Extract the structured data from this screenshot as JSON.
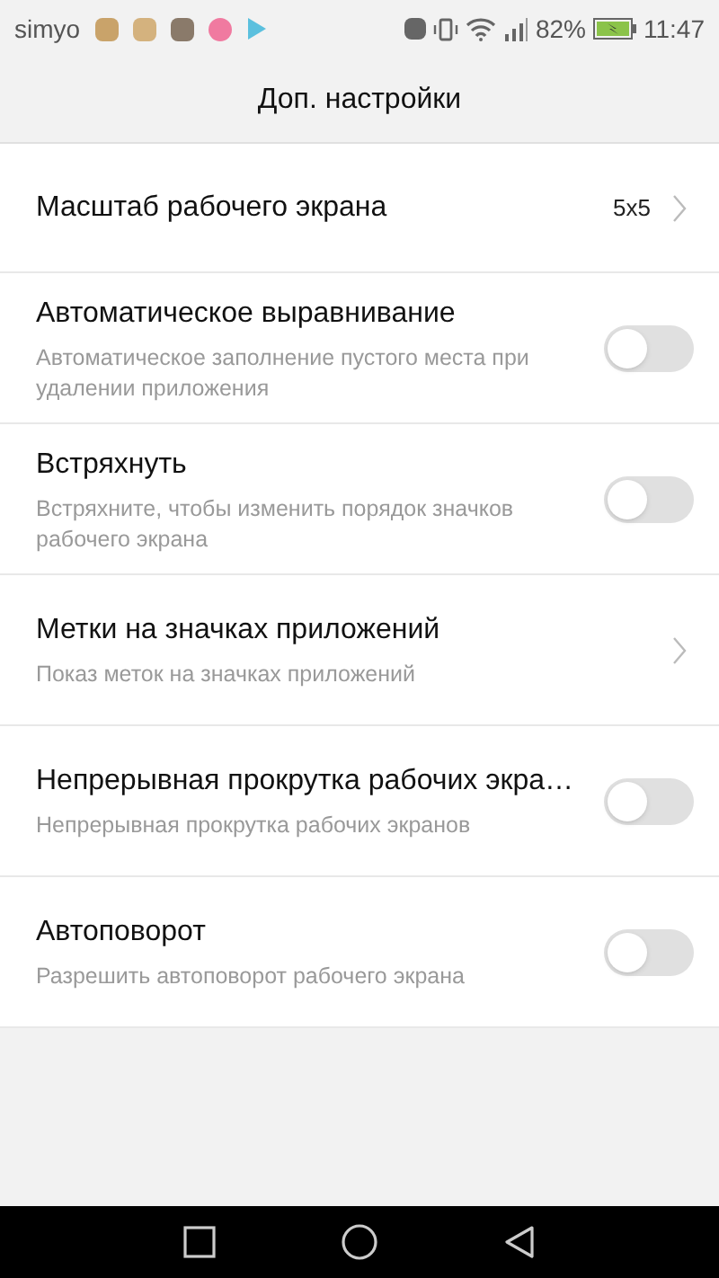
{
  "status_bar": {
    "carrier": "simyo",
    "battery_percent": "82%",
    "time": "11:47"
  },
  "title": "Доп. настройки",
  "items": [
    {
      "kind": "chevron",
      "title": "Масштаб рабочего экрана",
      "value": "5x5"
    },
    {
      "kind": "toggle",
      "title": "Автоматическое выравнивание",
      "subtitle": "Автоматическое заполнение пустого места при удалении приложения",
      "on": false
    },
    {
      "kind": "toggle",
      "title": "Встряхнуть",
      "subtitle": "Встряхните, чтобы изменить порядок значков рабочего экрана",
      "on": false
    },
    {
      "kind": "chevron",
      "title": "Метки на значках приложений",
      "subtitle": "Показ меток на значках приложений"
    },
    {
      "kind": "toggle",
      "title": "Непрерывная прокрутка рабочих экра…",
      "subtitle": "Непрерывная прокрутка рабочих экранов",
      "on": false
    },
    {
      "kind": "toggle",
      "title": "Автоповорот",
      "subtitle": "Разрешить автоповорот рабочего экрана",
      "on": false
    }
  ]
}
